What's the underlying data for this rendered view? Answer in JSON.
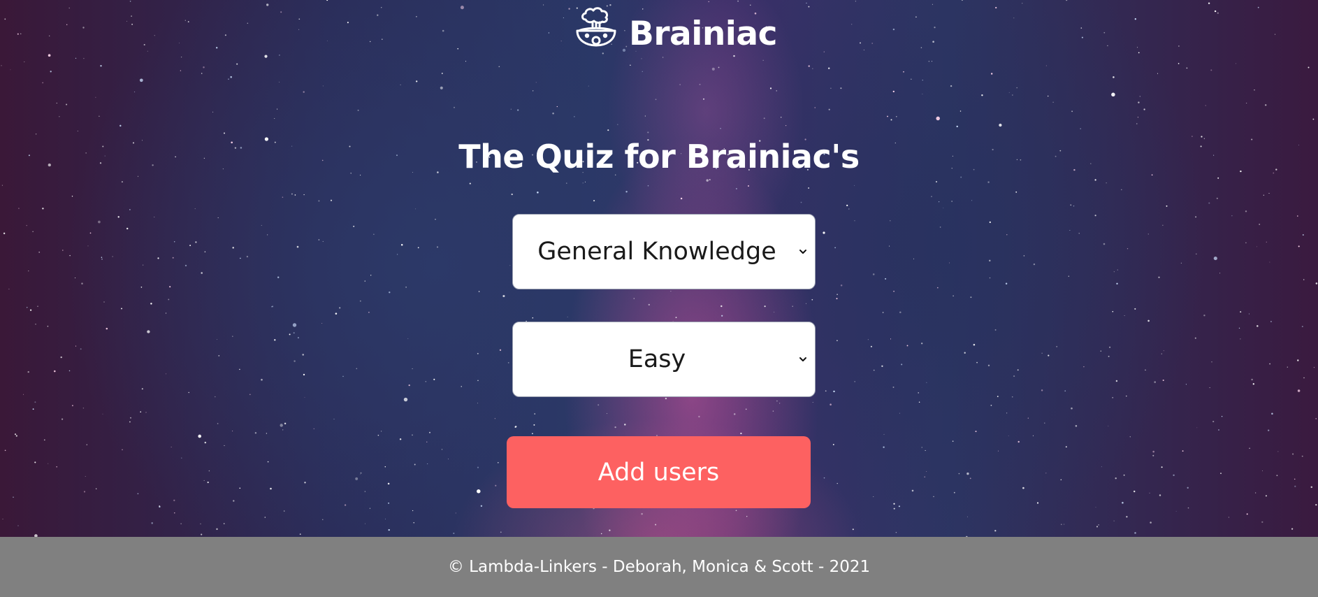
{
  "app": {
    "brand_name": "Brainiac",
    "logo_icon": "exploding-head-icon"
  },
  "main": {
    "title": "The Quiz for Brainiac's",
    "category_select": {
      "selected": "General Knowledge",
      "icon": "chevron-down-icon"
    },
    "difficulty_select": {
      "selected": "Easy",
      "icon": "chevron-down-icon"
    },
    "add_users_label": "Add users"
  },
  "footer": {
    "text": "© Lambda-Linkers - Deborah, Monica & Scott - 2021"
  },
  "colors": {
    "accent_button": "#fd6161",
    "footer_bg": "#808080",
    "text_light": "#ffffff"
  }
}
